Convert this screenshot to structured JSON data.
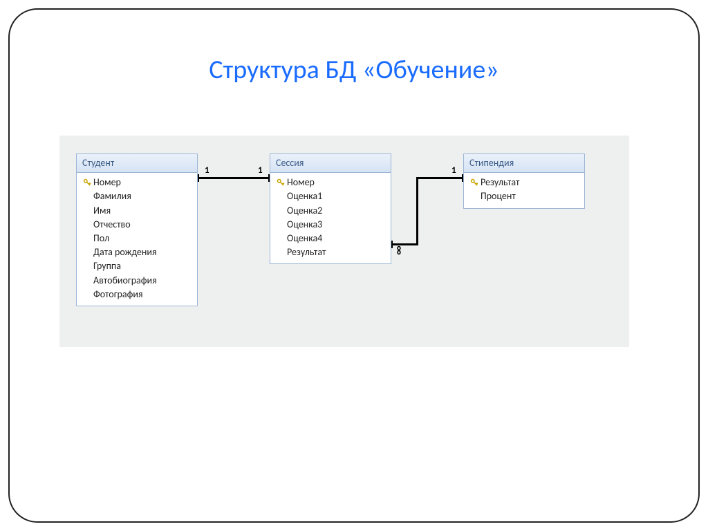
{
  "title": "Структура БД «Обучение»",
  "entities": {
    "student": {
      "name": "Студент",
      "fields": [
        "Номер",
        "Фамилия",
        "Имя",
        "Отчество",
        "Пол",
        "Дата рождения",
        "Группа",
        "Автобиография",
        "Фотография"
      ],
      "keys": [
        true,
        false,
        false,
        false,
        false,
        false,
        false,
        false,
        false
      ]
    },
    "session": {
      "name": "Сессия",
      "fields": [
        "Номер",
        "Оценка1",
        "Оценка2",
        "Оценка3",
        "Оценка4",
        "Результат"
      ],
      "keys": [
        true,
        false,
        false,
        false,
        false,
        false
      ]
    },
    "stipend": {
      "name": "Стипендия",
      "fields": [
        "Результат",
        "Процент"
      ],
      "keys": [
        true,
        false
      ]
    }
  },
  "relations": [
    {
      "from": "student",
      "to": "session",
      "left": "1",
      "right": "1"
    },
    {
      "from": "session",
      "to": "stipend",
      "left": "∞",
      "right": "1"
    }
  ]
}
